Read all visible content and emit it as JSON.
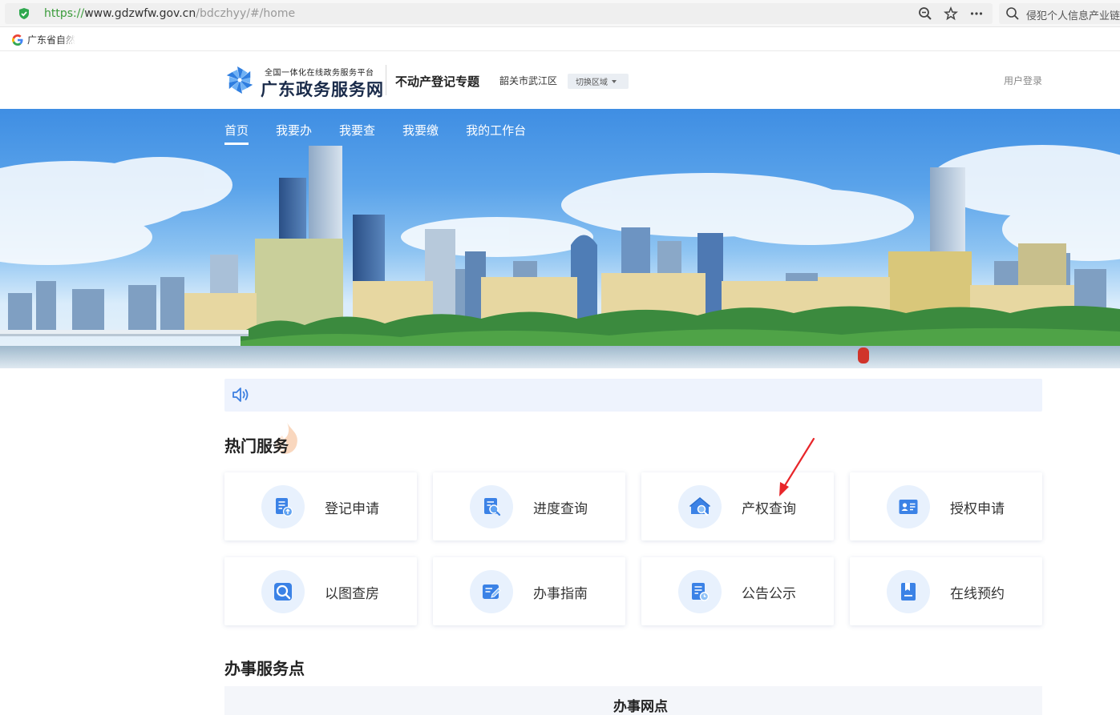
{
  "browser": {
    "url_scheme": "https://",
    "url_host": "www.gdzwfw.gov.cn",
    "url_path": "/bdczhyy/#/home",
    "search_text": "侵犯个人信息产业链",
    "bookmark_label": "广东省自然"
  },
  "header": {
    "platform_subtitle": "全国一体化在线政务服务平台",
    "site_title": "广东政务服务网",
    "topic": "不动产登记专题",
    "region": "韶关市武江区",
    "switch_region": "切换区域",
    "login": "用户登录"
  },
  "nav": {
    "items": [
      "首页",
      "我要办",
      "我要查",
      "我要缴",
      "我的工作台"
    ]
  },
  "hot_services": {
    "title": "热门服务",
    "items": [
      {
        "label": "登记申请",
        "icon": "document-upload-icon"
      },
      {
        "label": "进度查询",
        "icon": "document-search-icon"
      },
      {
        "label": "产权查询",
        "icon": "house-search-icon"
      },
      {
        "label": "授权申请",
        "icon": "id-card-icon"
      },
      {
        "label": "以图查房",
        "icon": "map-search-icon"
      },
      {
        "label": "办事指南",
        "icon": "guide-edit-icon"
      },
      {
        "label": "公告公示",
        "icon": "notice-clock-icon"
      },
      {
        "label": "在线预约",
        "icon": "bookmark-icon"
      }
    ]
  },
  "service_points": {
    "title": "办事服务点",
    "column_header": "办事网点"
  },
  "colors": {
    "brand_blue": "#2f7ee0",
    "icon_bg": "#e8f1fd",
    "annotation_red": "#e8262a"
  }
}
